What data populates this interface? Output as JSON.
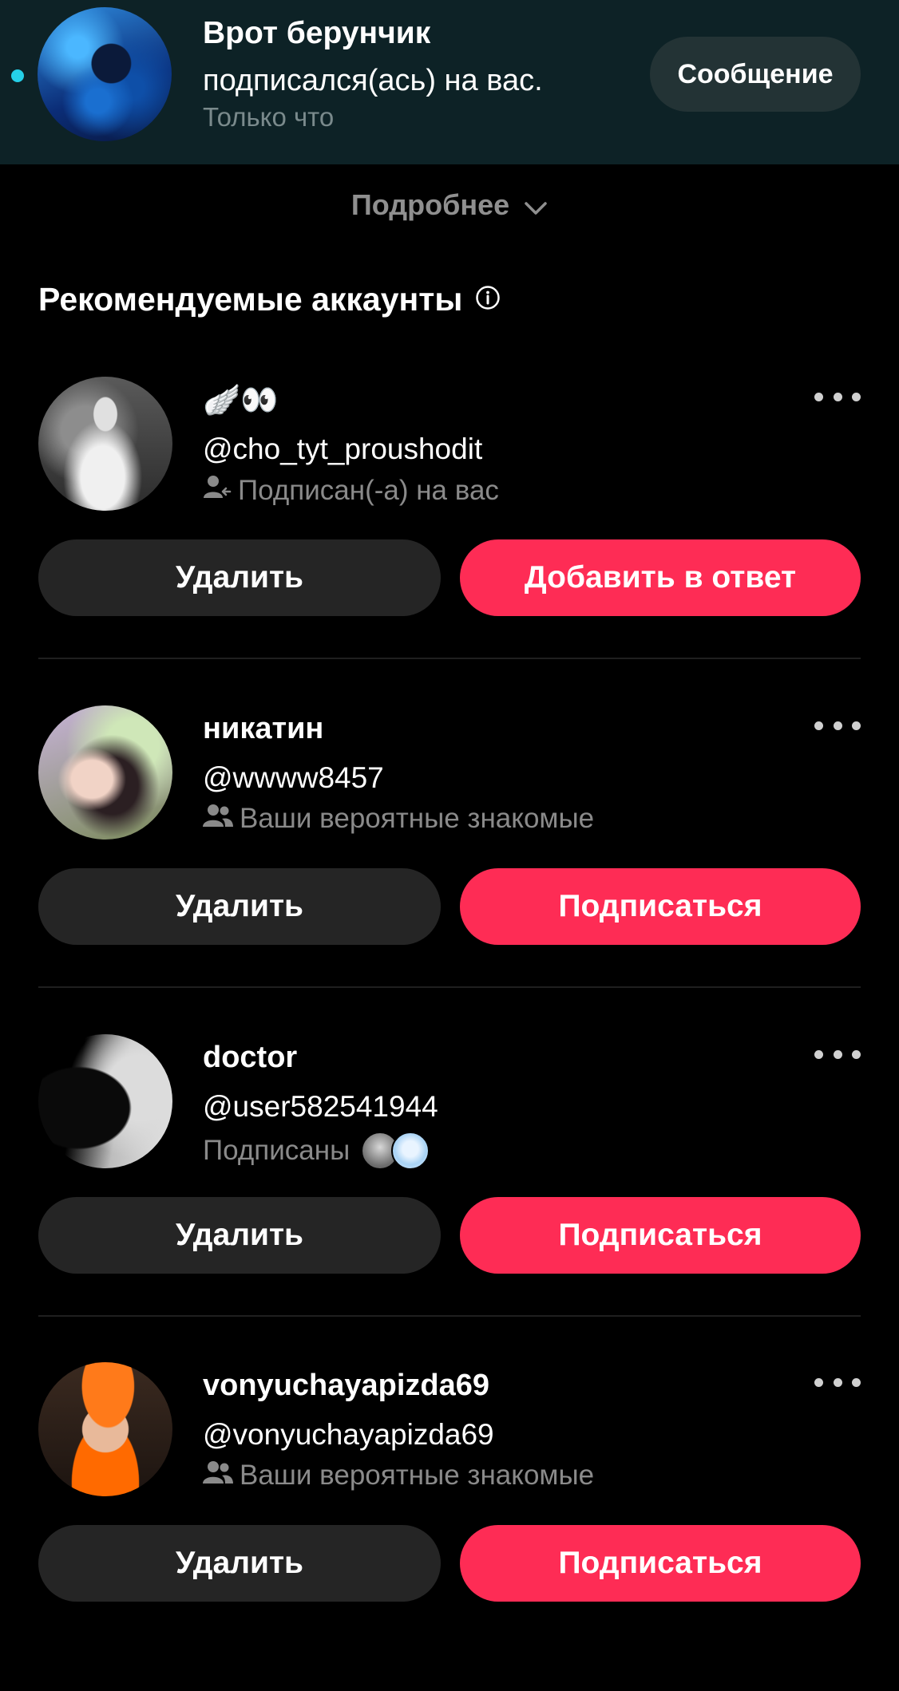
{
  "notification": {
    "name": "Врот берунчик",
    "action": "подписался(ась) на вас.",
    "time": "Только что",
    "message_button": "Сообщение",
    "unread_color": "#25d0e8"
  },
  "more_label": "Подробнее",
  "section_title": "Рекомендуемые аккаунты",
  "cards": [
    {
      "name": "🪽👀",
      "handle": "@cho_tyt_proushodit",
      "reason": "Подписан(-а) на вас",
      "reason_icon": "user-follow-icon",
      "remove_label": "Удалить",
      "primary_label": "Добавить в ответ"
    },
    {
      "name": "никатин",
      "handle": "@wwww8457",
      "reason": "Ваши вероятные знакомые",
      "reason_icon": "users-icon",
      "remove_label": "Удалить",
      "primary_label": "Подписаться"
    },
    {
      "name": "doctor",
      "handle": "@user582541944",
      "reason": "Подписаны",
      "reason_icon": "mutual-avatars",
      "remove_label": "Удалить",
      "primary_label": "Подписаться"
    },
    {
      "name": "vonyuchayapizda69",
      "handle": "@vonyuchayapizda69",
      "reason": "Ваши вероятные знакомые",
      "reason_icon": "users-icon",
      "remove_label": "Удалить",
      "primary_label": "Подписаться"
    }
  ],
  "colors": {
    "primary": "#fe2c55",
    "secondary": "#252525",
    "background": "#000000"
  }
}
